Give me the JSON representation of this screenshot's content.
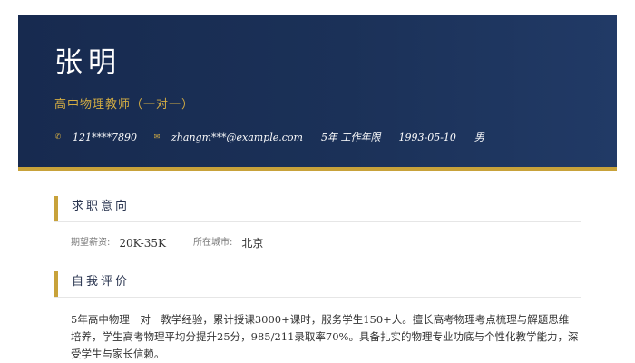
{
  "header": {
    "name": "张明",
    "role": "高中物理教师（一对一）",
    "contact": {
      "phone_icon": "phone-icon",
      "phone": "121****7890",
      "email_icon": "mail-icon",
      "email": "zhangm***@example.com",
      "experience": "5年 工作年限",
      "birthdate": "1993-05-10",
      "gender": "男"
    }
  },
  "intent": {
    "title": "求职意向",
    "salary_label": "期望薪资:",
    "salary_value": "20K-35K",
    "city_label": "所在城市:",
    "city_value": "北京"
  },
  "summary": {
    "title": "自我评价",
    "text": "5年高中物理一对一教学经验，累计授课3000+课时，服务学生150+人。擅长高考物理考点梳理与解题思维培养，学生高考物理平均分提升25分，985/211录取率70%。具备扎实的物理专业功底与个性化教学能力，深受学生与家长信赖。"
  },
  "colors": {
    "header_bg": "#1b3158",
    "accent_gold": "#c8a23a",
    "text_dark": "#333333"
  }
}
